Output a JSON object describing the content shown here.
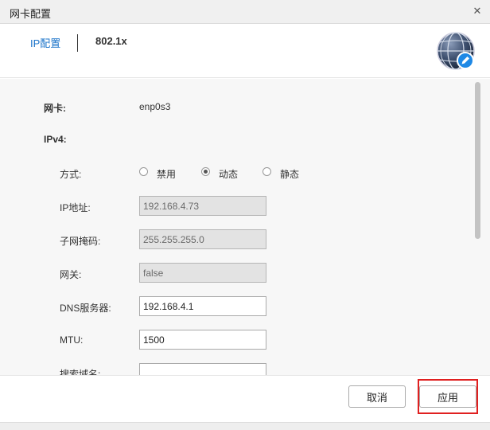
{
  "window": {
    "title": "网卡配置"
  },
  "tabs": [
    {
      "label": "IP配置",
      "active": true
    },
    {
      "label": "802.1x",
      "active": false
    }
  ],
  "nic": {
    "label": "网卡:",
    "value": "enp0s3"
  },
  "ipv4": {
    "section_label": "IPv4:",
    "method": {
      "label": "方式:",
      "options": [
        "禁用",
        "动态",
        "静态"
      ],
      "selected": "动态"
    },
    "ip": {
      "label": "IP地址:",
      "value": "192.168.4.73"
    },
    "subnet": {
      "label": "子网掩码:",
      "value": "255.255.255.0"
    },
    "gateway": {
      "label": "网关:",
      "value": "false"
    },
    "dns": {
      "label": "DNS服务器:",
      "value": "192.168.4.1"
    },
    "mtu": {
      "label": "MTU:",
      "value": "1500"
    },
    "search_domain": {
      "label": "搜索域名:",
      "value": ""
    }
  },
  "buttons": {
    "cancel": "取消",
    "apply": "应用"
  },
  "colors": {
    "accent": "#1a73c9",
    "highlight": "#e02020"
  },
  "icons": {
    "close": "close-icon",
    "globe": "globe-edit-icon"
  }
}
